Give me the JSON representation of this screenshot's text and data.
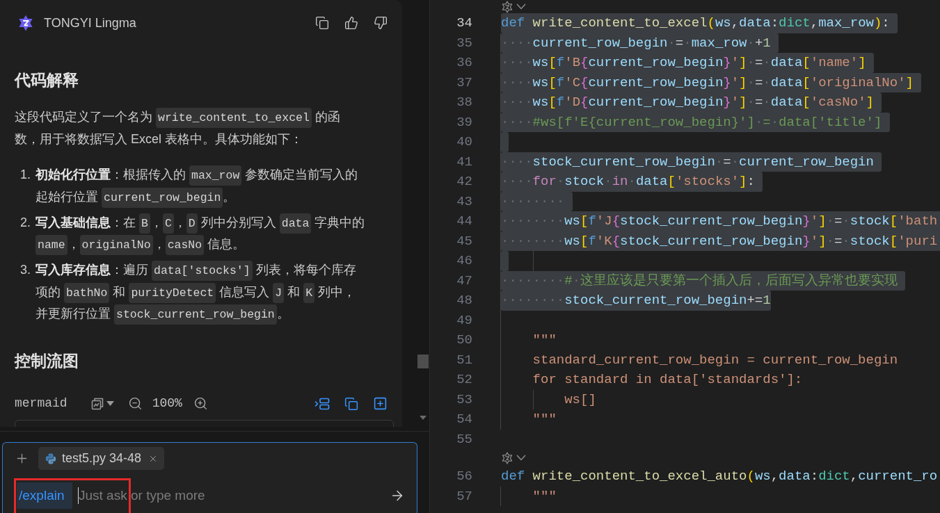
{
  "chat": {
    "title": "TONGYI Lingma",
    "heading": "代码解释",
    "intro": [
      {
        "kind": "text",
        "text": "这段代码定义了一个名为 "
      },
      {
        "kind": "code",
        "text": "write_content_to_excel"
      },
      {
        "kind": "text",
        "text": " 的函数，用于将数据写入 Excel 表格中。具体功能如下："
      }
    ],
    "steps": [
      {
        "number": "1.",
        "segments": [
          {
            "kind": "bold",
            "text": "初始化行位置"
          },
          {
            "kind": "text",
            "text": "：根据传入的 "
          },
          {
            "kind": "code",
            "text": "max_row"
          },
          {
            "kind": "text",
            "text": " 参数确定当前写入的起始行位置 "
          },
          {
            "kind": "code",
            "text": "current_row_begin"
          },
          {
            "kind": "text",
            "text": "。"
          }
        ]
      },
      {
        "number": "2.",
        "segments": [
          {
            "kind": "bold",
            "text": "写入基础信息"
          },
          {
            "kind": "text",
            "text": "：在 "
          },
          {
            "kind": "code",
            "text": "B"
          },
          {
            "kind": "text",
            "text": "，"
          },
          {
            "kind": "code",
            "text": "C"
          },
          {
            "kind": "text",
            "text": "，"
          },
          {
            "kind": "code",
            "text": "D"
          },
          {
            "kind": "text",
            "text": " 列中分别写入 "
          },
          {
            "kind": "code",
            "text": "data"
          },
          {
            "kind": "text",
            "text": " 字典中的 "
          },
          {
            "kind": "code",
            "text": "name"
          },
          {
            "kind": "text",
            "text": "，"
          },
          {
            "kind": "code",
            "text": "originalNo"
          },
          {
            "kind": "text",
            "text": "，"
          },
          {
            "kind": "code",
            "text": "casNo"
          },
          {
            "kind": "text",
            "text": " 信息。"
          }
        ]
      },
      {
        "number": "3.",
        "segments": [
          {
            "kind": "bold",
            "text": "写入库存信息"
          },
          {
            "kind": "text",
            "text": "：遍历 "
          },
          {
            "kind": "code",
            "text": "data['stocks']"
          },
          {
            "kind": "text",
            "text": " 列表，将每个库存项的 "
          },
          {
            "kind": "code",
            "text": "bathNo"
          },
          {
            "kind": "text",
            "text": " 和 "
          },
          {
            "kind": "code",
            "text": "purityDetect"
          },
          {
            "kind": "text",
            "text": " 信息写入 "
          },
          {
            "kind": "code",
            "text": "J"
          },
          {
            "kind": "text",
            "text": " 和 "
          },
          {
            "kind": "code",
            "text": "K"
          },
          {
            "kind": "text",
            "text": " 列中，并更新行位置 "
          },
          {
            "kind": "code",
            "text": "stock_current_row_begin"
          },
          {
            "kind": "text",
            "text": "。"
          }
        ]
      }
    ],
    "flow_heading": "控制流图",
    "diagram_toolbar": {
      "language": "mermaid",
      "zoom": "100%"
    }
  },
  "composer": {
    "context_chip": "test5.py 34-48",
    "command": "/explain",
    "placeholder": "Just ask or type more"
  },
  "editor": {
    "lines": [
      {
        "kind": "codelens"
      },
      {
        "kind": "code",
        "number": "34",
        "active": true,
        "selected": true,
        "guide": false,
        "inner_guide": false,
        "tokens": [
          {
            "kind": "keyword",
            "text": "def"
          },
          {
            "kind": "function",
            "text": " write_content_to_excel"
          },
          {
            "kind": "bracket",
            "text": "("
          },
          {
            "kind": "variable",
            "text": "ws"
          },
          {
            "kind": "operator",
            "text": ","
          },
          {
            "kind": "variable",
            "text": "data"
          },
          {
            "kind": "operator",
            "text": ":"
          },
          {
            "kind": "type",
            "text": "dict"
          },
          {
            "kind": "operator",
            "text": ","
          },
          {
            "kind": "variable",
            "text": "max_row"
          },
          {
            "kind": "bracket",
            "text": ")"
          },
          {
            "kind": "operator",
            "text": ":"
          }
        ]
      },
      {
        "kind": "code",
        "number": "35",
        "active": false,
        "selected": true,
        "guide": true,
        "inner_guide": false,
        "tokens": [
          {
            "kind": "whitespace",
            "text": "····"
          },
          {
            "kind": "variable",
            "text": "current_row_begin"
          },
          {
            "kind": "whitespace",
            "text": "·"
          },
          {
            "kind": "operator",
            "text": "="
          },
          {
            "kind": "whitespace",
            "text": "·"
          },
          {
            "kind": "variable",
            "text": "max_row"
          },
          {
            "kind": "whitespace",
            "text": "·"
          },
          {
            "kind": "operator",
            "text": "+"
          },
          {
            "kind": "number",
            "text": "1"
          }
        ]
      },
      {
        "kind": "code",
        "number": "36",
        "active": false,
        "selected": true,
        "guide": true,
        "inner_guide": false,
        "tokens": [
          {
            "kind": "whitespace",
            "text": "····"
          },
          {
            "kind": "variable",
            "text": "ws"
          },
          {
            "kind": "bracket",
            "text": "["
          },
          {
            "kind": "prefix",
            "text": "f"
          },
          {
            "kind": "string",
            "text": "'B"
          },
          {
            "kind": "brace",
            "text": "{"
          },
          {
            "kind": "variable",
            "text": "current_row_begin"
          },
          {
            "kind": "brace",
            "text": "}"
          },
          {
            "kind": "string",
            "text": "'"
          },
          {
            "kind": "bracket",
            "text": "]"
          },
          {
            "kind": "whitespace",
            "text": "·"
          },
          {
            "kind": "operator",
            "text": "="
          },
          {
            "kind": "whitespace",
            "text": "·"
          },
          {
            "kind": "variable",
            "text": "data"
          },
          {
            "kind": "bracket",
            "text": "["
          },
          {
            "kind": "string",
            "text": "'name'"
          },
          {
            "kind": "bracket",
            "text": "]"
          }
        ]
      },
      {
        "kind": "code",
        "number": "37",
        "active": false,
        "selected": true,
        "guide": true,
        "inner_guide": false,
        "tokens": [
          {
            "kind": "whitespace",
            "text": "····"
          },
          {
            "kind": "variable",
            "text": "ws"
          },
          {
            "kind": "bracket",
            "text": "["
          },
          {
            "kind": "prefix",
            "text": "f"
          },
          {
            "kind": "string",
            "text": "'C"
          },
          {
            "kind": "brace",
            "text": "{"
          },
          {
            "kind": "variable",
            "text": "current_row_begin"
          },
          {
            "kind": "brace",
            "text": "}"
          },
          {
            "kind": "string",
            "text": "'"
          },
          {
            "kind": "bracket",
            "text": "]"
          },
          {
            "kind": "whitespace",
            "text": "·"
          },
          {
            "kind": "operator",
            "text": "="
          },
          {
            "kind": "whitespace",
            "text": "·"
          },
          {
            "kind": "variable",
            "text": "data"
          },
          {
            "kind": "bracket",
            "text": "["
          },
          {
            "kind": "string",
            "text": "'originalNo'"
          },
          {
            "kind": "bracket",
            "text": "]"
          }
        ]
      },
      {
        "kind": "code",
        "number": "38",
        "active": false,
        "selected": true,
        "guide": true,
        "inner_guide": false,
        "tokens": [
          {
            "kind": "whitespace",
            "text": "····"
          },
          {
            "kind": "variable",
            "text": "ws"
          },
          {
            "kind": "bracket",
            "text": "["
          },
          {
            "kind": "prefix",
            "text": "f"
          },
          {
            "kind": "string",
            "text": "'D"
          },
          {
            "kind": "brace",
            "text": "{"
          },
          {
            "kind": "variable",
            "text": "current_row_begin"
          },
          {
            "kind": "brace",
            "text": "}"
          },
          {
            "kind": "string",
            "text": "'"
          },
          {
            "kind": "bracket",
            "text": "]"
          },
          {
            "kind": "whitespace",
            "text": "·"
          },
          {
            "kind": "operator",
            "text": "="
          },
          {
            "kind": "whitespace",
            "text": "·"
          },
          {
            "kind": "variable",
            "text": "data"
          },
          {
            "kind": "bracket",
            "text": "["
          },
          {
            "kind": "string",
            "text": "'casNo'"
          },
          {
            "kind": "bracket",
            "text": "]"
          }
        ]
      },
      {
        "kind": "code",
        "number": "39",
        "active": false,
        "selected": true,
        "guide": true,
        "inner_guide": false,
        "tokens": [
          {
            "kind": "whitespace",
            "text": "····"
          },
          {
            "kind": "comment",
            "text": "#ws[f'E{current_row_begin}']"
          },
          {
            "kind": "whitespace",
            "text": "·"
          },
          {
            "kind": "comment",
            "text": "="
          },
          {
            "kind": "whitespace",
            "text": "·"
          },
          {
            "kind": "comment",
            "text": "data['title']"
          }
        ]
      },
      {
        "kind": "code",
        "number": "40",
        "active": false,
        "selected": true,
        "guide": true,
        "inner_guide": false
      },
      {
        "kind": "code",
        "number": "41",
        "active": false,
        "selected": true,
        "guide": true,
        "inner_guide": false,
        "tokens": [
          {
            "kind": "whitespace",
            "text": "····"
          },
          {
            "kind": "variable",
            "text": "stock_current_row_begin"
          },
          {
            "kind": "whitespace",
            "text": "·"
          },
          {
            "kind": "operator",
            "text": "="
          },
          {
            "kind": "whitespace",
            "text": "·"
          },
          {
            "kind": "variable",
            "text": "current_row_begin"
          }
        ]
      },
      {
        "kind": "code",
        "number": "42",
        "active": false,
        "selected": true,
        "guide": true,
        "inner_guide": false,
        "tokens": [
          {
            "kind": "whitespace",
            "text": "····"
          },
          {
            "kind": "control",
            "text": "for"
          },
          {
            "kind": "whitespace",
            "text": "·"
          },
          {
            "kind": "variable",
            "text": "stock"
          },
          {
            "kind": "whitespace",
            "text": "·"
          },
          {
            "kind": "control",
            "text": "in"
          },
          {
            "kind": "whitespace",
            "text": "·"
          },
          {
            "kind": "variable",
            "text": "data"
          },
          {
            "kind": "bracket",
            "text": "["
          },
          {
            "kind": "string",
            "text": "'stocks'"
          },
          {
            "kind": "bracket",
            "text": "]"
          },
          {
            "kind": "operator",
            "text": ":"
          }
        ]
      },
      {
        "kind": "code",
        "number": "43",
        "active": false,
        "selected": true,
        "guide": true,
        "inner_guide": false,
        "tokens": [
          {
            "kind": "whitespace",
            "text": "········"
          }
        ]
      },
      {
        "kind": "code",
        "number": "44",
        "active": false,
        "selected": true,
        "guide": true,
        "inner_guide": false,
        "tokens": [
          {
            "kind": "whitespace",
            "text": "········"
          },
          {
            "kind": "variable",
            "text": "ws"
          },
          {
            "kind": "bracket",
            "text": "["
          },
          {
            "kind": "prefix",
            "text": "f"
          },
          {
            "kind": "string",
            "text": "'J"
          },
          {
            "kind": "brace",
            "text": "{"
          },
          {
            "kind": "variable",
            "text": "stock_current_row_begin"
          },
          {
            "kind": "brace",
            "text": "}"
          },
          {
            "kind": "string",
            "text": "'"
          },
          {
            "kind": "bracket",
            "text": "]"
          },
          {
            "kind": "whitespace",
            "text": "·"
          },
          {
            "kind": "operator",
            "text": "="
          },
          {
            "kind": "whitespace",
            "text": "·"
          },
          {
            "kind": "variable",
            "text": "stock"
          },
          {
            "kind": "bracket",
            "text": "["
          },
          {
            "kind": "string",
            "text": "'bath"
          }
        ]
      },
      {
        "kind": "code",
        "number": "45",
        "active": false,
        "selected": true,
        "guide": true,
        "inner_guide": false,
        "tokens": [
          {
            "kind": "whitespace",
            "text": "········"
          },
          {
            "kind": "variable",
            "text": "ws"
          },
          {
            "kind": "bracket",
            "text": "["
          },
          {
            "kind": "prefix",
            "text": "f"
          },
          {
            "kind": "string",
            "text": "'K"
          },
          {
            "kind": "brace",
            "text": "{"
          },
          {
            "kind": "variable",
            "text": "stock_current_row_begin"
          },
          {
            "kind": "brace",
            "text": "}"
          },
          {
            "kind": "string",
            "text": "'"
          },
          {
            "kind": "bracket",
            "text": "]"
          },
          {
            "kind": "whitespace",
            "text": "·"
          },
          {
            "kind": "operator",
            "text": "="
          },
          {
            "kind": "whitespace",
            "text": "·"
          },
          {
            "kind": "variable",
            "text": "stock"
          },
          {
            "kind": "bracket",
            "text": "["
          },
          {
            "kind": "string",
            "text": "'puri"
          }
        ]
      },
      {
        "kind": "code",
        "number": "46",
        "active": false,
        "selected": true,
        "guide": true,
        "inner_guide": true
      },
      {
        "kind": "code",
        "number": "47",
        "active": false,
        "selected": true,
        "guide": true,
        "inner_guide": false,
        "tokens": [
          {
            "kind": "whitespace",
            "text": "········"
          },
          {
            "kind": "comment",
            "text": "#"
          },
          {
            "kind": "whitespace",
            "text": "·"
          },
          {
            "kind": "comment",
            "text": "这里应该是只要第一个插入后，后面写入异常也要实现"
          }
        ]
      },
      {
        "kind": "code",
        "number": "48",
        "active": false,
        "selected": true,
        "guide": true,
        "inner_guide": false,
        "tokens": [
          {
            "kind": "whitespace",
            "text": "········"
          },
          {
            "kind": "variable",
            "text": "stock_current_row_begin"
          },
          {
            "kind": "operator",
            "text": "+="
          },
          {
            "kind": "number",
            "text": "1"
          }
        ]
      },
      {
        "kind": "code",
        "number": "49",
        "active": false,
        "selected": false,
        "guide": true,
        "inner_guide": false
      },
      {
        "kind": "code",
        "number": "50",
        "active": false,
        "selected": false,
        "guide": true,
        "inner_guide": false,
        "tokens": [
          {
            "kind": "string",
            "text": "    \"\"\""
          }
        ]
      },
      {
        "kind": "code",
        "number": "51",
        "active": false,
        "selected": false,
        "guide": true,
        "inner_guide": false,
        "tokens": [
          {
            "kind": "string",
            "text": "    standard_current_row_begin = current_row_begin"
          }
        ]
      },
      {
        "kind": "code",
        "number": "52",
        "active": false,
        "selected": false,
        "guide": true,
        "inner_guide": false,
        "tokens": [
          {
            "kind": "string",
            "text": "    for standard in data['standards']:"
          }
        ]
      },
      {
        "kind": "code",
        "number": "53",
        "active": false,
        "selected": false,
        "guide": true,
        "inner_guide": true,
        "tokens": [
          {
            "kind": "string",
            "text": "        ws[]"
          }
        ]
      },
      {
        "kind": "code",
        "number": "54",
        "active": false,
        "selected": false,
        "guide": true,
        "inner_guide": false,
        "tokens": [
          {
            "kind": "string",
            "text": "    \"\"\""
          }
        ]
      },
      {
        "kind": "code",
        "number": "55",
        "active": false,
        "selected": false,
        "guide": false,
        "inner_guide": false
      },
      {
        "kind": "codelens"
      },
      {
        "kind": "code",
        "number": "56",
        "active": false,
        "selected": false,
        "guide": false,
        "inner_guide": false,
        "tokens": [
          {
            "kind": "keyword",
            "text": "def"
          },
          {
            "kind": "function",
            "text": " write_content_to_excel_auto"
          },
          {
            "kind": "bracket",
            "text": "("
          },
          {
            "kind": "variable",
            "text": "ws"
          },
          {
            "kind": "operator",
            "text": ","
          },
          {
            "kind": "variable",
            "text": "data"
          },
          {
            "kind": "operator",
            "text": ":"
          },
          {
            "kind": "type",
            "text": "dict"
          },
          {
            "kind": "operator",
            "text": ","
          },
          {
            "kind": "variable",
            "text": "current_ro"
          }
        ]
      },
      {
        "kind": "code",
        "number": "57",
        "active": false,
        "selected": false,
        "guide": true,
        "inner_guide": false,
        "tokens": [
          {
            "kind": "string",
            "text": "    \"\"\""
          }
        ]
      }
    ]
  }
}
